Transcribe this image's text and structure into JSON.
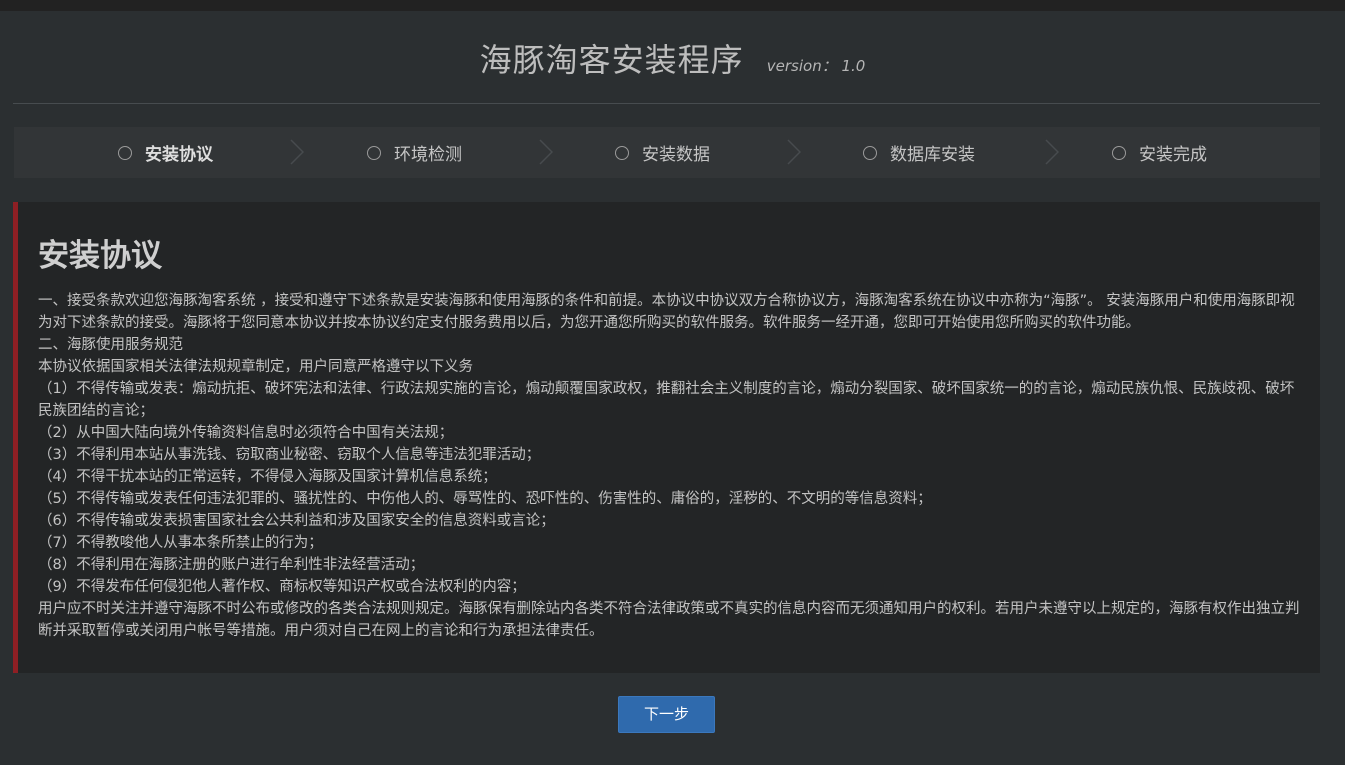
{
  "header": {
    "title": "海豚淘客安装程序",
    "version": "version： 1.0"
  },
  "steps": [
    {
      "label": "安装协议",
      "active": true
    },
    {
      "label": "环境检测",
      "active": false
    },
    {
      "label": "安装数据",
      "active": false
    },
    {
      "label": "数据库安装",
      "active": false
    },
    {
      "label": "安装完成",
      "active": false
    }
  ],
  "agreement": {
    "title": "安装协议",
    "paragraphs": [
      "一、接受条款欢迎您海豚淘客系统 ，接受和遵守下述条款是安装海豚和使用海豚的条件和前提。本协议中协议双方合称协议方，海豚淘客系统在协议中亦称为“海豚”。 安装海豚用户和使用海豚即视为对下述条款的接受。海豚将于您同意本协议并按本协议约定支付服务费用以后，为您开通您所购买的软件服务。软件服务一经开通，您即可开始使用您所购买的软件功能。",
      "二、海豚使用服务规范",
      "本协议依据国家相关法律法规规章制定，用户同意严格遵守以下义务",
      "（1）不得传输或发表：煽动抗拒、破坏宪法和法律、行政法规实施的言论，煽动颠覆国家政权，推翻社会主义制度的言论，煽动分裂国家、破坏国家统一的的言论，煽动民族仇恨、民族歧视、破坏民族团结的言论；",
      "（2）从中国大陆向境外传输资料信息时必须符合中国有关法规；",
      "（3）不得利用本站从事洗钱、窃取商业秘密、窃取个人信息等违法犯罪活动；",
      "（4）不得干扰本站的正常运转，不得侵入海豚及国家计算机信息系统；",
      "（5）不得传输或发表任何违法犯罪的、骚扰性的、中伤他人的、辱骂性的、恐吓性的、伤害性的、庸俗的，淫秽的、不文明的等信息资料；",
      "（6）不得传输或发表损害国家社会公共利益和涉及国家安全的信息资料或言论；",
      "（7）不得教唆他人从事本条所禁止的行为；",
      "（8）不得利用在海豚注册的账户进行牟利性非法经营活动；",
      "（9）不得发布任何侵犯他人著作权、商标权等知识产权或合法权利的内容；",
      "用户应不时关注并遵守海豚不时公布或修改的各类合法规则规定。海豚保有删除站内各类不符合法律政策或不真实的信息内容而无须通知用户的权利。若用户未遵守以上规定的，海豚有权作出独立判断并采取暂停或关闭用户帐号等措施。用户须对自己在网上的言论和行为承担法律责任。"
    ]
  },
  "footer": {
    "next_label": "下一步"
  },
  "colors": {
    "background": "#2b2f31",
    "panel": "#232526",
    "accent_border": "#8e1f24",
    "primary_button": "#2f6aad"
  }
}
